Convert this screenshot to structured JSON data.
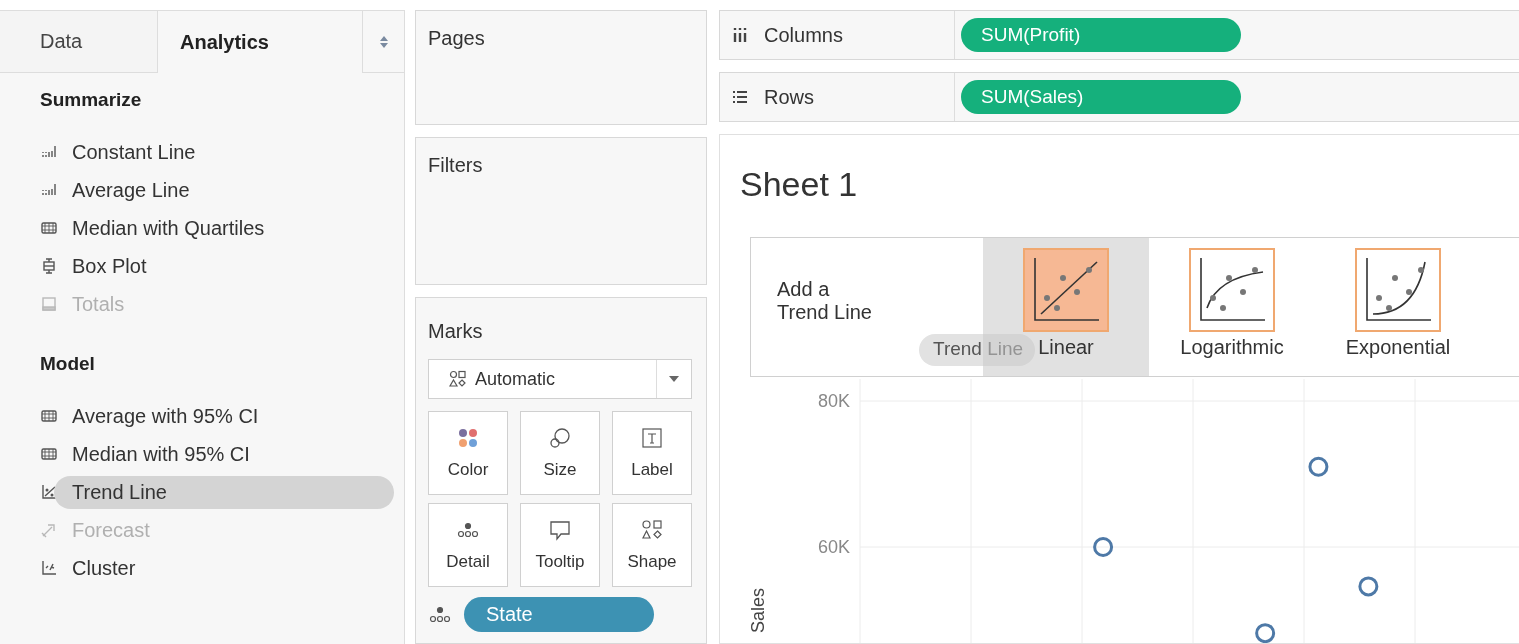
{
  "tabs": [
    {
      "label": "Data",
      "selected": false
    },
    {
      "label": "Analytics",
      "selected": true
    }
  ],
  "analytics": {
    "sections": [
      {
        "title": "Summarize",
        "items": [
          {
            "label": "Constant Line",
            "disabled": false,
            "selected": false
          },
          {
            "label": "Average Line",
            "disabled": false,
            "selected": false
          },
          {
            "label": "Median with Quartiles",
            "disabled": false,
            "selected": false
          },
          {
            "label": "Box Plot",
            "disabled": false,
            "selected": false
          },
          {
            "label": "Totals",
            "disabled": true,
            "selected": false
          }
        ]
      },
      {
        "title": "Model",
        "items": [
          {
            "label": "Average with 95% CI",
            "disabled": false,
            "selected": false
          },
          {
            "label": "Median with 95% CI",
            "disabled": false,
            "selected": false
          },
          {
            "label": "Trend Line",
            "disabled": false,
            "selected": true
          },
          {
            "label": "Forecast",
            "disabled": true,
            "selected": false
          },
          {
            "label": "Cluster",
            "disabled": false,
            "selected": false
          }
        ]
      }
    ]
  },
  "pages": {
    "title": "Pages"
  },
  "filters": {
    "title": "Filters"
  },
  "marks": {
    "title": "Marks",
    "mark_type": "Automatic",
    "cards": [
      "Color",
      "Size",
      "Label",
      "Detail",
      "Tooltip",
      "Shape"
    ],
    "fields": [
      {
        "label": "State",
        "color": "#3d92b3"
      }
    ]
  },
  "shelves": [
    {
      "label": "Columns",
      "pill": "SUM(Profit)",
      "color": "#15b07c"
    },
    {
      "label": "Rows",
      "pill": "SUM(Sales)",
      "color": "#15b07c"
    }
  ],
  "sheet": {
    "title": "Sheet 1",
    "trend_overlay": {
      "prompt_line1": "Add a",
      "prompt_line2": "Trend Line",
      "drag_label": "Trend Line",
      "options": [
        {
          "label": "Linear",
          "highlighted": true
        },
        {
          "label": "Logarithmic",
          "highlighted": false
        },
        {
          "label": "Exponential",
          "highlighted": false
        }
      ]
    },
    "plot": {
      "axis_title": "Sales",
      "tick_labels": [
        "80K",
        "60K"
      ]
    }
  }
}
